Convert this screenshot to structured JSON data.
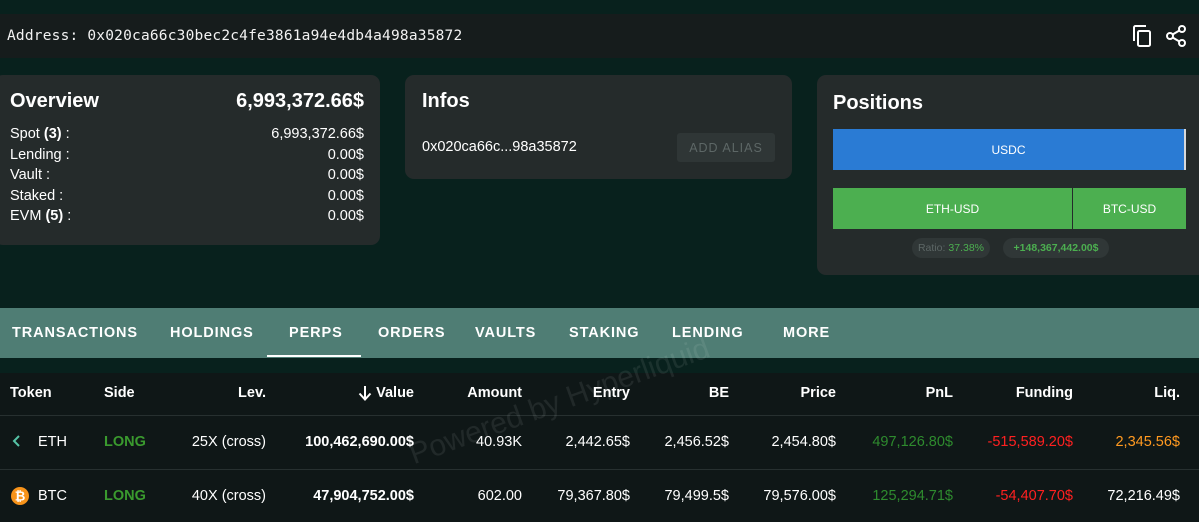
{
  "address": {
    "label": "Address: 0x020ca66c30bec2c4fe3861a94e4db4a498a35872",
    "copy_icon": "copy-icon",
    "share_icon": "share-icon"
  },
  "overview": {
    "title": "Overview",
    "total": "6,993,372.66$",
    "rows": [
      {
        "label": "Spot",
        "count": "(3)",
        "suffix": " :",
        "value": "6,993,372.66$"
      },
      {
        "label": "Lending :",
        "count": "",
        "suffix": "",
        "value": "0.00$"
      },
      {
        "label": "Vault :",
        "count": "",
        "suffix": "",
        "value": "0.00$"
      },
      {
        "label": "Staked :",
        "count": "",
        "suffix": "",
        "value": "0.00$"
      },
      {
        "label": "EVM",
        "count": "(5)",
        "suffix": " :",
        "value": "0.00$"
      }
    ]
  },
  "infos": {
    "title": "Infos",
    "short_address": "0x020ca66c...98a35872",
    "alias_button": "ADD ALIAS"
  },
  "positions": {
    "title": "Positions",
    "usdc_label": "USDC",
    "eth_label": "ETH-USD",
    "btc_label": "BTC-USD",
    "ratio_label": "Ratio:",
    "ratio_value": "37.38%",
    "pnl": "+148,367,442.00$"
  },
  "tabs": {
    "items": [
      "TRANSACTIONS",
      "HOLDINGS",
      "PERPS",
      "ORDERS",
      "VAULTS",
      "STAKING",
      "LENDING",
      "MORE"
    ],
    "active": "PERPS"
  },
  "table": {
    "headers": [
      "Token",
      "Side",
      "Lev.",
      "Value",
      "Amount",
      "Entry",
      "BE",
      "Price",
      "PnL",
      "Funding",
      "Liq."
    ],
    "sort_icon": "arrow-down-icon",
    "rows": [
      {
        "token": "ETH",
        "side": "LONG",
        "lev": "25X (cross)",
        "value": "100,462,690.00$",
        "amount": "40.93K",
        "entry": "2,442.65$",
        "be": "2,456.52$",
        "price": "2,454.80$",
        "pnl": "497,126.80$",
        "funding": "-515,589.20$",
        "liq": "2,345.56$"
      },
      {
        "token": "BTC",
        "side": "LONG",
        "lev": "40X (cross)",
        "value": "47,904,752.00$",
        "amount": "602.00",
        "entry": "79,367.80$",
        "be": "79,499.5$",
        "price": "79,576.00$",
        "pnl": "125,294.71$",
        "funding": "-54,407.70$",
        "liq": "72,216.49$"
      }
    ]
  },
  "watermark": "Powered by Hyperliquid",
  "colors": {
    "background": "#08211d",
    "card": "#252b2b",
    "tabs": "#4f7d74",
    "usdc": "#2a7bd4",
    "long": "#4caf50",
    "negative": "#ff2020",
    "liquidation": "#ff9920"
  }
}
